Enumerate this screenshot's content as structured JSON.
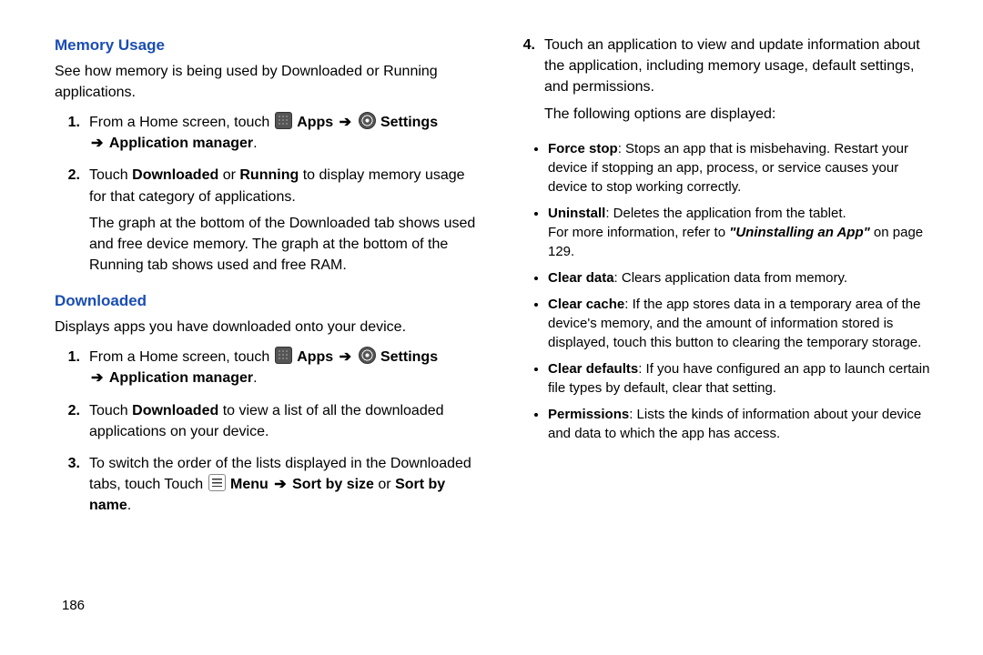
{
  "pageNumber": "186",
  "left": {
    "memory": {
      "heading": "Memory Usage",
      "intro": "See how memory is being used by Downloaded or Running applications.",
      "step1_lead": "From a Home screen, touch ",
      "apps": "Apps",
      "settings": "Settings",
      "appmgr": "Application manager",
      "step2a": "Touch ",
      "step2_dl": "Downloaded",
      "step2_mid": " or ",
      "step2_run": "Running",
      "step2b": " to display memory usage for that category of applications.",
      "step2_para2": "The graph at the bottom of the Downloaded tab shows used and free device memory. The graph at the bottom of the Running tab shows used and free RAM."
    },
    "downloaded": {
      "heading": "Downloaded",
      "intro": "Displays apps you have downloaded onto your device.",
      "step1_lead": "From a Home screen, touch ",
      "apps": "Apps",
      "settings": "Settings",
      "appmgr": "Application manager",
      "step2a": "Touch ",
      "step2_dl": "Downloaded",
      "step2b": " to view a list of all the downloaded applications on your device.",
      "step3a": "To switch the order of the lists displayed in the Downloaded tabs, touch Touch ",
      "menu": "Menu",
      "sortsize": "Sort by size",
      "step3_mid": " or ",
      "sortname": "Sort by name"
    }
  },
  "right": {
    "step4a": "Touch an application to view and update information about the application, including memory usage, default settings, and permissions.",
    "step4b": "The following options are displayed:",
    "bullets": {
      "fs_b": "Force stop",
      "fs": ": Stops an app that is misbehaving. Restart your device if stopping an app, process, or service causes your device to stop working correctly.",
      "un_b": "Uninstall",
      "un": ": Deletes the application from the tablet.",
      "un_ref1": "For more information, refer to ",
      "un_ref_ital": "\"Uninstalling an App\"",
      "un_ref2": " on page 129.",
      "cd_b": "Clear data",
      "cd": ": Clears application data from memory.",
      "cc_b": "Clear cache",
      "cc": ": If the app stores data in a temporary area of the device's memory, and the amount of information stored is displayed, touch this button to clearing the temporary storage.",
      "cdef_b": "Clear defaults",
      "cdef": ": If you have configured an app to launch certain file types by default, clear that setting.",
      "perm_b": "Permissions",
      "perm": ": Lists the kinds of information about your device and data to which the app has access."
    }
  }
}
